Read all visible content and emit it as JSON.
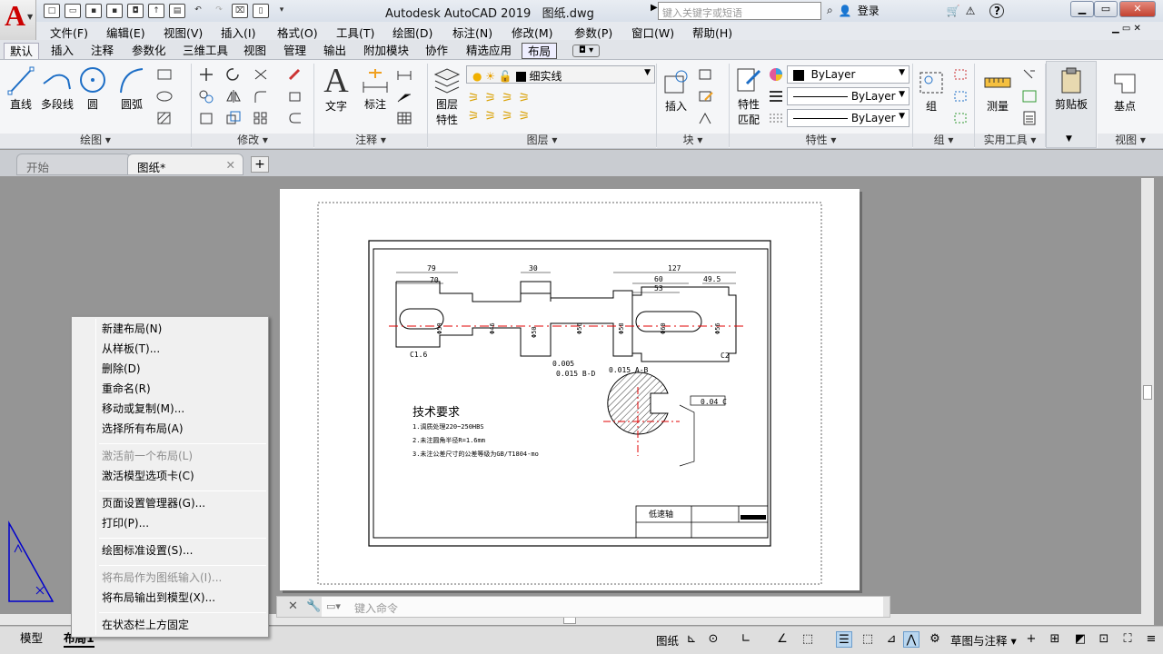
{
  "window": {
    "title": "Autodesk AutoCAD 2019",
    "filename": "图纸.dwg",
    "search_placeholder": "键入关键字或短语",
    "login_label": "登录",
    "help_label": "?"
  },
  "menubar": [
    "文件(F)",
    "编辑(E)",
    "视图(V)",
    "插入(I)",
    "格式(O)",
    "工具(T)",
    "绘图(D)",
    "标注(N)",
    "修改(M)",
    "参数(P)",
    "窗口(W)",
    "帮助(H)"
  ],
  "ribbon_tabs": [
    "默认",
    "插入",
    "注释",
    "参数化",
    "三维工具",
    "视图",
    "管理",
    "输出",
    "附加模块",
    "协作",
    "精选应用",
    "布局"
  ],
  "ribbon": {
    "draw": {
      "line": "直线",
      "polyline": "多段线",
      "circle": "圆",
      "arc": "圆弧",
      "panel": "绘图"
    },
    "modify": {
      "panel": "修改"
    },
    "annotation": {
      "text": "文字",
      "dimension": "标注",
      "panel": "注释"
    },
    "layers": {
      "layer_props_1": "图层",
      "layer_props_2": "特性",
      "current_layer": "细实线",
      "panel": "图层"
    },
    "block": {
      "insert": "插入",
      "panel": "块"
    },
    "properties": {
      "match_1": "特性",
      "match_2": "匹配",
      "color": "ByLayer",
      "linetype": "ByLayer",
      "lineweight": "ByLayer",
      "panel": "特性"
    },
    "groups": {
      "group": "组",
      "panel": "组"
    },
    "utilities": {
      "measure": "测量",
      "panel": "实用工具"
    },
    "clipboard": {
      "paste": "剪贴板"
    },
    "view": {
      "base": "基点",
      "panel": "视图"
    }
  },
  "doc_tabs": [
    "开始",
    "图纸*"
  ],
  "drawing": {
    "section_title": "技术要求",
    "notes": [
      "1.调质处理220~250HBS",
      "2.未注圆角半径R=1.6mm",
      "3.未注公差尺寸的公差等级为GB/T1804-mo"
    ],
    "part_name": "低速轴",
    "dims_top": [
      "79",
      "70",
      "30",
      "127",
      "60",
      "53",
      "49.5"
    ],
    "dims_vert": [
      "Φ46",
      "Φ50",
      "Φ56",
      "Φ58",
      "Φ60",
      "Φ56",
      "Φ50"
    ],
    "tolerances": [
      "0.005",
      "0.015 B-D",
      "0.015 A-B",
      "0.04 C"
    ],
    "chamfers": [
      "C1.6",
      "C2"
    ]
  },
  "context_menu": {
    "items": [
      {
        "label": "新建布局(N)",
        "disabled": false
      },
      {
        "label": "从样板(T)...",
        "disabled": false
      },
      {
        "label": "删除(D)",
        "disabled": false
      },
      {
        "label": "重命名(R)",
        "disabled": false
      },
      {
        "label": "移动或复制(M)...",
        "disabled": false
      },
      {
        "label": "选择所有布局(A)",
        "disabled": false
      },
      {
        "label": "激活前一个布局(L)",
        "disabled": true
      },
      {
        "label": "激活模型选项卡(C)",
        "disabled": false
      },
      {
        "label": "页面设置管理器(G)...",
        "disabled": false
      },
      {
        "label": "打印(P)...",
        "disabled": false
      },
      {
        "label": "绘图标准设置(S)...",
        "disabled": false
      },
      {
        "label": "将布局作为图纸输入(I)...",
        "disabled": true
      },
      {
        "label": "将布局输出到模型(X)...",
        "disabled": false
      },
      {
        "label": "在状态栏上方固定",
        "disabled": false
      }
    ]
  },
  "command_line": {
    "placeholder": "键入命令"
  },
  "status_bar": {
    "model_tab": "模型",
    "layout_tab": "布局1",
    "paper_label": "图纸",
    "workspace": "草图与注释"
  },
  "colors": {
    "accent": "#c00000",
    "ucs": "#0000cc",
    "centerline": "#e00000"
  }
}
